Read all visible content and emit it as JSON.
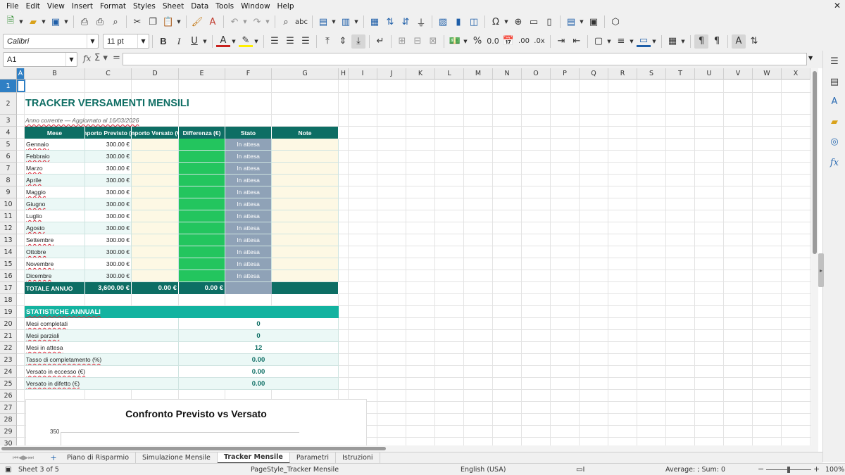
{
  "menu": [
    "File",
    "Edit",
    "View",
    "Insert",
    "Format",
    "Styles",
    "Sheet",
    "Data",
    "Tools",
    "Window",
    "Help"
  ],
  "toolbar": {
    "font_name": "Calibri",
    "font_size": "11 pt"
  },
  "formula_bar": {
    "cell_ref": "A1",
    "formula": ""
  },
  "columns": [
    "A",
    "B",
    "C",
    "D",
    "E",
    "F",
    "G",
    "H",
    "I",
    "J",
    "K",
    "L",
    "M",
    "N",
    "O",
    "P",
    "Q",
    "R",
    "S",
    "T",
    "U",
    "V",
    "W",
    "X"
  ],
  "rows": [
    "1",
    "2",
    "3",
    "4",
    "5",
    "6",
    "7",
    "8",
    "9",
    "10",
    "11",
    "12",
    "13",
    "14",
    "15",
    "16",
    "17",
    "18",
    "19",
    "20",
    "21",
    "22",
    "23",
    "24",
    "25",
    "26",
    "27",
    "28",
    "29",
    "30"
  ],
  "sheet": {
    "title": "TRACKER VERSAMENTI MENSILI",
    "subtitle": "Anno corrente — Aggiornato al 16/03/2026",
    "headers": [
      "Mese",
      "Importo Previsto (€)",
      "Importo Versato (€)",
      "Differenza (€)",
      "Stato",
      "Note"
    ],
    "months": [
      {
        "mese": "Gennaio",
        "previsto": "300.00 €",
        "stato": "In attesa"
      },
      {
        "mese": "Febbraio",
        "previsto": "300.00 €",
        "stato": "In attesa"
      },
      {
        "mese": "Marzo",
        "previsto": "300.00 €",
        "stato": "In attesa"
      },
      {
        "mese": "Aprile",
        "previsto": "300.00 €",
        "stato": "In attesa"
      },
      {
        "mese": "Maggio",
        "previsto": "300.00 €",
        "stato": "In attesa"
      },
      {
        "mese": "Giugno",
        "previsto": "300.00 €",
        "stato": "In attesa"
      },
      {
        "mese": "Luglio",
        "previsto": "300.00 €",
        "stato": "In attesa"
      },
      {
        "mese": "Agosto",
        "previsto": "300.00 €",
        "stato": "In attesa"
      },
      {
        "mese": "Settembre",
        "previsto": "300.00 €",
        "stato": "In attesa"
      },
      {
        "mese": "Ottobre",
        "previsto": "300.00 €",
        "stato": "In attesa"
      },
      {
        "mese": "Novembre",
        "previsto": "300.00 €",
        "stato": "In attesa"
      },
      {
        "mese": "Dicembre",
        "previsto": "300.00 €",
        "stato": "In attesa"
      }
    ],
    "totals": {
      "label": "TOTALE ANNUO",
      "previsto": "3,600.00 €",
      "versato": "0.00 €",
      "differenza": "0.00 €"
    },
    "stats_title": "STATISTICHE ANNUALI",
    "stats": [
      {
        "label": "Mesi completati",
        "value": "0"
      },
      {
        "label": "Mesi parziali",
        "value": "0"
      },
      {
        "label": "Mesi in attesa",
        "value": "12"
      },
      {
        "label": "Tasso di completamento (%)",
        "value": "0.00"
      },
      {
        "label": "Versato in eccesso (€)",
        "value": "0.00"
      },
      {
        "label": "Versato in difetto (€)",
        "value": "0.00"
      }
    ],
    "chart_title": "Confronto Previsto vs Versato",
    "chart_y_tick": "350"
  },
  "tabs": [
    "Piano di Risparmio",
    "Simulazione Mensile",
    "Tracker Mensile",
    "Parametri",
    "Istruzioni"
  ],
  "active_tab": "Tracker Mensile",
  "status": {
    "sheet": "Sheet 3 of 5",
    "page_style": "PageStyle_Tracker Mensile",
    "language": "English (USA)",
    "summary": "Average: ; Sum: 0",
    "zoom": "100%"
  },
  "colors": {
    "header_teal": "#0d6e64",
    "stats_teal": "#13b3a0",
    "diff_green": "#23c55e",
    "stato_gray": "#8fa2b7",
    "input_cream": "#fdf8e4",
    "selection_blue": "#2f7fc4"
  }
}
